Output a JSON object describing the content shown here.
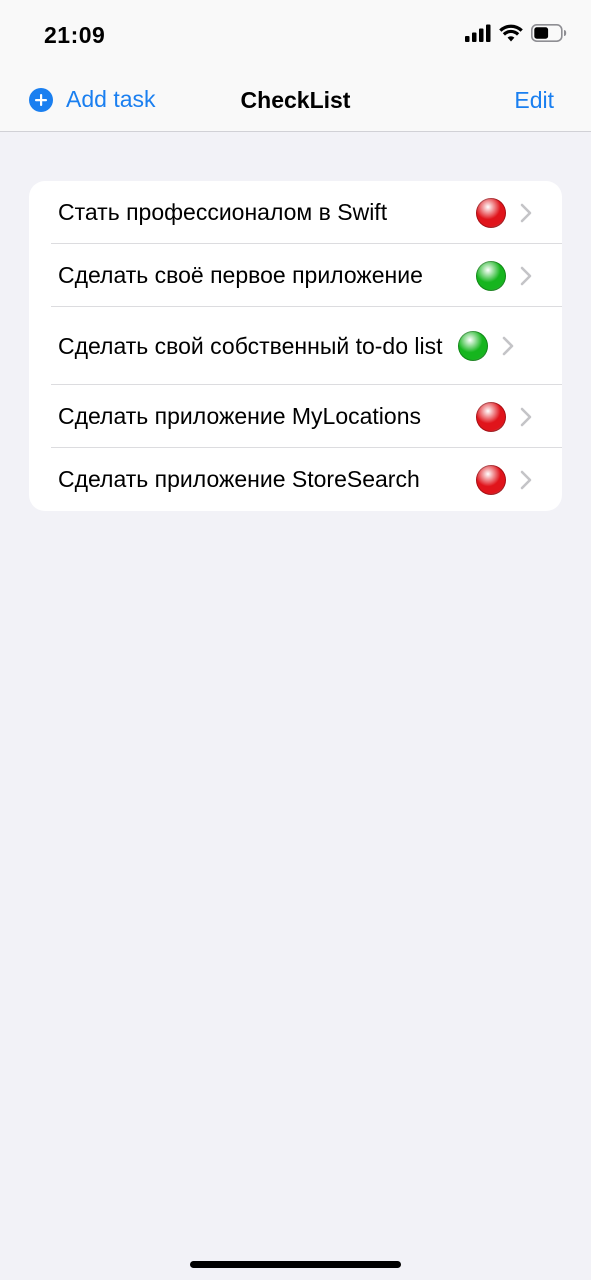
{
  "status": {
    "time": "21:09",
    "icons": [
      "signal-icon",
      "wifi-icon",
      "battery-icon"
    ],
    "battery_level": 0.55
  },
  "nav": {
    "add_label": "Add task",
    "title": "CheckList",
    "edit_label": "Edit",
    "accent_color": "#1a7ff0"
  },
  "tasks": [
    {
      "label": "Стать профессионалом в Swift",
      "status": "red"
    },
    {
      "label": "Сделать своё первое приложение",
      "status": "green"
    },
    {
      "label": "Сделать свой собственный to-do list",
      "status": "green"
    },
    {
      "label": "Сделать приложение MyLocations",
      "status": "red"
    },
    {
      "label": "Сделать приложение StoreSearch",
      "status": "red"
    }
  ],
  "status_colors": {
    "red": "#e0141b",
    "green": "#16b51e"
  }
}
